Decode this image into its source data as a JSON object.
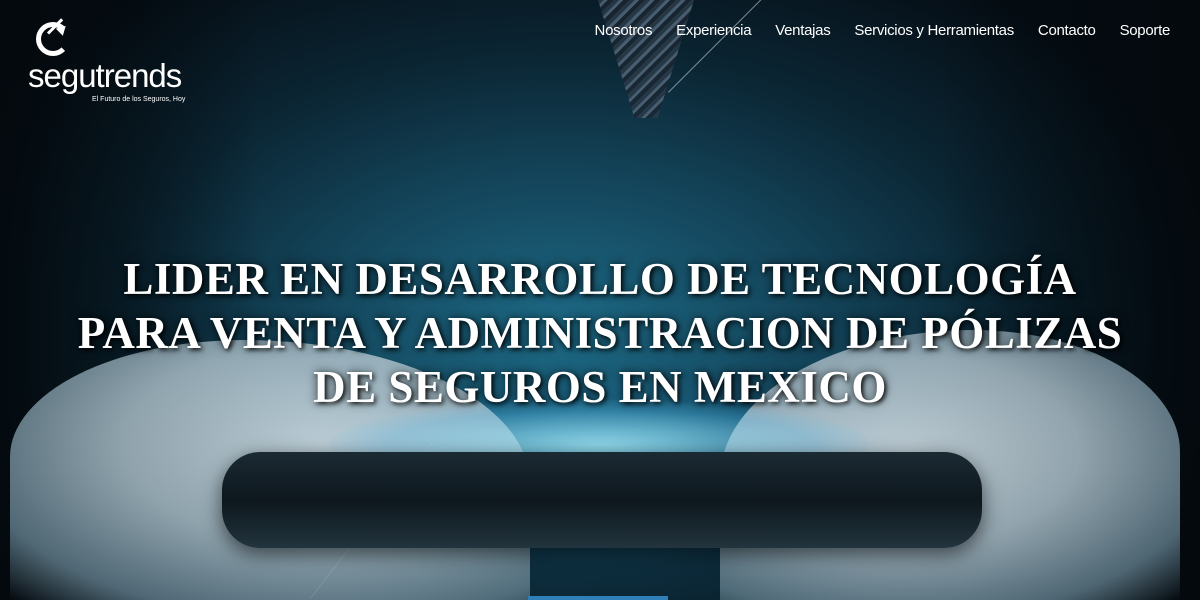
{
  "brand": {
    "name": "segutrends",
    "tagline": "El Futuro de los Seguros, Hoy"
  },
  "nav": {
    "items": [
      {
        "label": "Nosotros"
      },
      {
        "label": "Experiencia"
      },
      {
        "label": "Ventajas"
      },
      {
        "label": "Servicios y Herramientas"
      },
      {
        "label": "Contacto"
      },
      {
        "label": "Soporte"
      }
    ]
  },
  "hero": {
    "headline_lines": [
      "LIDER EN DESARROLLO DE TECNOLOGÍA",
      "PARA VENTA Y ADMINISTRACION DE PÓLIZAS",
      "DE SEGUROS EN MEXICO"
    ]
  },
  "colors": {
    "text": "#ffffff",
    "accent": "#2f7fb8"
  }
}
